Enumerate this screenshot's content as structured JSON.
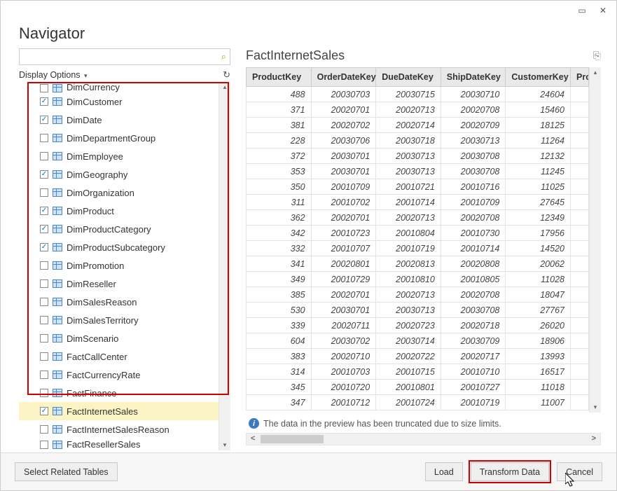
{
  "header": {
    "title": "Navigator"
  },
  "search": {
    "placeholder": ""
  },
  "displayOptions": {
    "label": "Display Options"
  },
  "tree": {
    "items": [
      {
        "label": "DimCurrency",
        "checked": false,
        "cut": true
      },
      {
        "label": "DimCustomer",
        "checked": true
      },
      {
        "label": "DimDate",
        "checked": true
      },
      {
        "label": "DimDepartmentGroup",
        "checked": false
      },
      {
        "label": "DimEmployee",
        "checked": false
      },
      {
        "label": "DimGeography",
        "checked": true
      },
      {
        "label": "DimOrganization",
        "checked": false
      },
      {
        "label": "DimProduct",
        "checked": true
      },
      {
        "label": "DimProductCategory",
        "checked": true
      },
      {
        "label": "DimProductSubcategory",
        "checked": true
      },
      {
        "label": "DimPromotion",
        "checked": false
      },
      {
        "label": "DimReseller",
        "checked": false
      },
      {
        "label": "DimSalesReason",
        "checked": false
      },
      {
        "label": "DimSalesTerritory",
        "checked": false
      },
      {
        "label": "DimScenario",
        "checked": false
      },
      {
        "label": "FactCallCenter",
        "checked": false
      },
      {
        "label": "FactCurrencyRate",
        "checked": false
      },
      {
        "label": "FactFinance",
        "checked": false
      },
      {
        "label": "FactInternetSales",
        "checked": true,
        "selected": true
      },
      {
        "label": "FactInternetSalesReason",
        "checked": false
      },
      {
        "label": "FactResellerSales",
        "checked": false,
        "cutBottom": true
      }
    ]
  },
  "preview": {
    "title": "FactInternetSales",
    "columns": [
      "ProductKey",
      "OrderDateKey",
      "DueDateKey",
      "ShipDateKey",
      "CustomerKey",
      "Pro"
    ],
    "rows": [
      [
        "488",
        "20030703",
        "20030715",
        "20030710",
        "24604"
      ],
      [
        "371",
        "20020701",
        "20020713",
        "20020708",
        "15460"
      ],
      [
        "381",
        "20020702",
        "20020714",
        "20020709",
        "18125"
      ],
      [
        "228",
        "20030706",
        "20030718",
        "20030713",
        "11264"
      ],
      [
        "372",
        "20030701",
        "20030713",
        "20030708",
        "12132"
      ],
      [
        "353",
        "20030701",
        "20030713",
        "20030708",
        "11245"
      ],
      [
        "350",
        "20010709",
        "20010721",
        "20010716",
        "11025"
      ],
      [
        "311",
        "20010702",
        "20010714",
        "20010709",
        "27645"
      ],
      [
        "362",
        "20020701",
        "20020713",
        "20020708",
        "12349"
      ],
      [
        "342",
        "20010723",
        "20010804",
        "20010730",
        "17956"
      ],
      [
        "332",
        "20010707",
        "20010719",
        "20010714",
        "14520"
      ],
      [
        "341",
        "20020801",
        "20020813",
        "20020808",
        "20062"
      ],
      [
        "349",
        "20010729",
        "20010810",
        "20010805",
        "11028"
      ],
      [
        "385",
        "20020701",
        "20020713",
        "20020708",
        "18047"
      ],
      [
        "530",
        "20030701",
        "20030713",
        "20030708",
        "27767"
      ],
      [
        "339",
        "20020711",
        "20020723",
        "20020718",
        "26020"
      ],
      [
        "604",
        "20030702",
        "20030714",
        "20030709",
        "18906"
      ],
      [
        "383",
        "20020710",
        "20020722",
        "20020717",
        "13993"
      ],
      [
        "314",
        "20010703",
        "20010715",
        "20010710",
        "16517"
      ],
      [
        "345",
        "20010720",
        "20010801",
        "20010727",
        "11018"
      ],
      [
        "347",
        "20010712",
        "20010724",
        "20010719",
        "11007"
      ]
    ],
    "info": "The data in the preview has been truncated due to size limits."
  },
  "footer": {
    "selectRelated": "Select Related Tables",
    "load": "Load",
    "transform": "Transform Data",
    "cancel": "Cancel"
  }
}
